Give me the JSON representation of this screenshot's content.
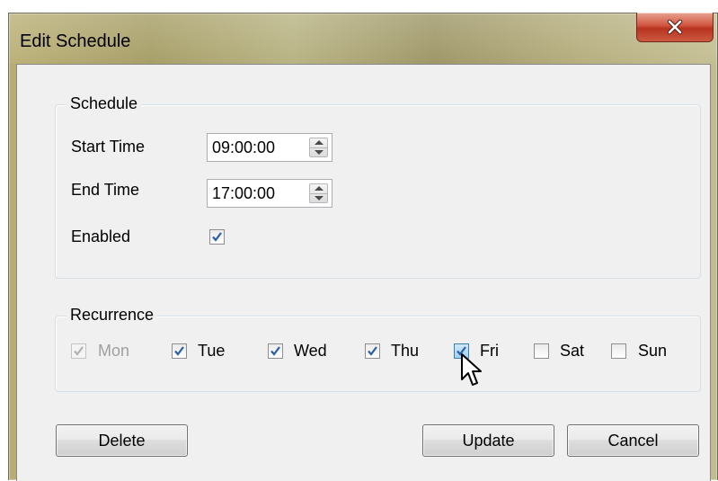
{
  "window": {
    "title": "Edit Schedule",
    "close_icon": "close-x-icon"
  },
  "schedule": {
    "legend": "Schedule",
    "start_time_label": "Start Time",
    "start_time_value": "09:00:00",
    "end_time_label": "End Time",
    "end_time_value": "17:00:00",
    "enabled_label": "Enabled",
    "enabled_checked": true
  },
  "recurrence": {
    "legend": "Recurrence",
    "days": [
      {
        "label": "Mon",
        "checked": true,
        "disabled": true
      },
      {
        "label": "Tue",
        "checked": true,
        "disabled": false
      },
      {
        "label": "Wed",
        "checked": true,
        "disabled": false
      },
      {
        "label": "Thu",
        "checked": true,
        "disabled": false
      },
      {
        "label": "Fri",
        "checked": true,
        "disabled": false,
        "hovered": true
      },
      {
        "label": "Sat",
        "checked": false,
        "disabled": false
      },
      {
        "label": "Sun",
        "checked": false,
        "disabled": false
      }
    ]
  },
  "buttons": {
    "delete": "Delete",
    "update": "Update",
    "cancel": "Cancel"
  },
  "colors": {
    "check_mark": "#2a5fa3",
    "close_button": "#c8452e",
    "dialog_background": "#f0f0f0"
  }
}
